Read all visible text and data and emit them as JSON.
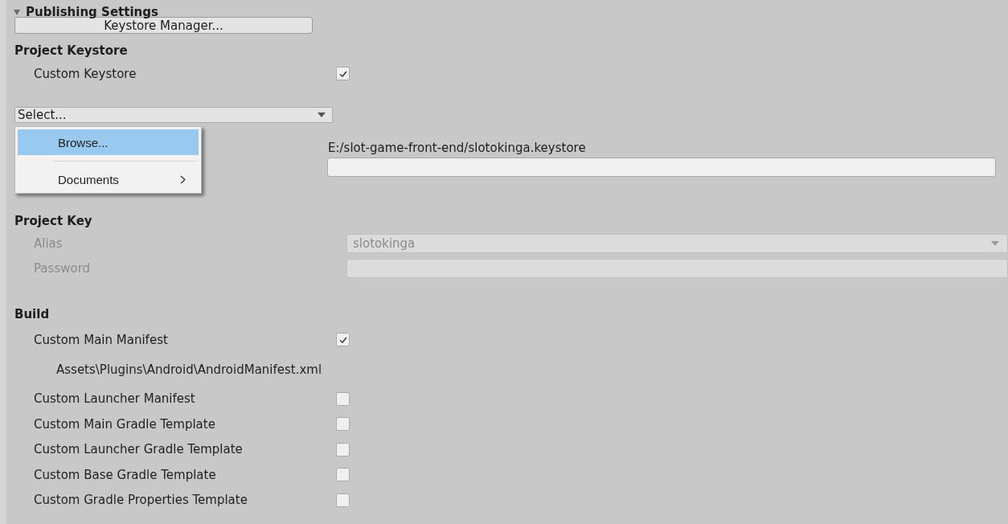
{
  "section": {
    "title": "Publishing Settings",
    "expanded": true
  },
  "keystore_manager_button": "Keystore Manager...",
  "project_keystore": {
    "heading": "Project Keystore",
    "custom_keystore": {
      "label": "Custom Keystore",
      "checked": true
    },
    "select": {
      "value": "Select..."
    },
    "menu": [
      {
        "label": "Browse...",
        "selected": true,
        "submenu": false
      },
      {
        "label": "Documents",
        "selected": false,
        "submenu": true
      }
    ],
    "path": "E:/slot-game-front-end/slotokinga.keystore"
  },
  "project_key": {
    "heading": "Project Key",
    "disabled": true,
    "alias": {
      "label": "Alias",
      "value": "slotokinga"
    },
    "password": {
      "label": "Password"
    }
  },
  "build": {
    "heading": "Build",
    "options": [
      {
        "kind": "checkbox",
        "label": "Custom Main Manifest",
        "checked": true
      },
      {
        "kind": "path",
        "text": "Assets\\Plugins\\Android\\AndroidManifest.xml"
      },
      {
        "kind": "checkbox",
        "label": "Custom Launcher Manifest",
        "checked": false
      },
      {
        "kind": "checkbox",
        "label": "Custom Main Gradle Template",
        "checked": false
      },
      {
        "kind": "checkbox",
        "label": "Custom Launcher Gradle Template",
        "checked": false
      },
      {
        "kind": "checkbox",
        "label": "Custom Base Gradle Template",
        "checked": false
      },
      {
        "kind": "checkbox",
        "label": "Custom Gradle Properties Template",
        "checked": false
      }
    ]
  }
}
